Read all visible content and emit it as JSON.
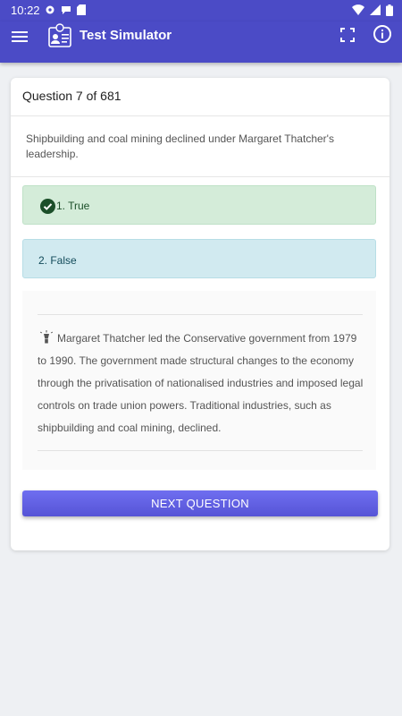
{
  "status_bar": {
    "time": "10:22"
  },
  "app_bar": {
    "title": "Test Simulator"
  },
  "question": {
    "header": "Question 7 of 681",
    "text": "Shipbuilding and coal mining declined under Margaret Thatcher's leadership."
  },
  "options": [
    {
      "label": "1. True",
      "state": "correct",
      "color": "#d4ecd9"
    },
    {
      "label": "2. False",
      "state": "neutral",
      "color": "#d1eaf0"
    }
  ],
  "explanation": {
    "text": "Margaret Thatcher led the Conservative government from 1979 to 1990. The government made structural changes to the economy through the privatisation of nationalised industries and imposed legal controls on trade union powers. Traditional industries, such as shipbuilding and coal mining, declined."
  },
  "next_button": {
    "label": "NEXT QUESTION"
  },
  "colors": {
    "primary": "#4b4bc6",
    "accent": "#6362e8",
    "correct": "#1b4f29"
  },
  "icons": [
    "settings-icon",
    "chat-icon",
    "sd-card-icon",
    "wifi-icon",
    "signal-icon",
    "battery-icon",
    "menu-icon",
    "app-logo-icon",
    "fullscreen-icon",
    "info-icon",
    "check-circle-icon",
    "lightbulb-icon"
  ]
}
